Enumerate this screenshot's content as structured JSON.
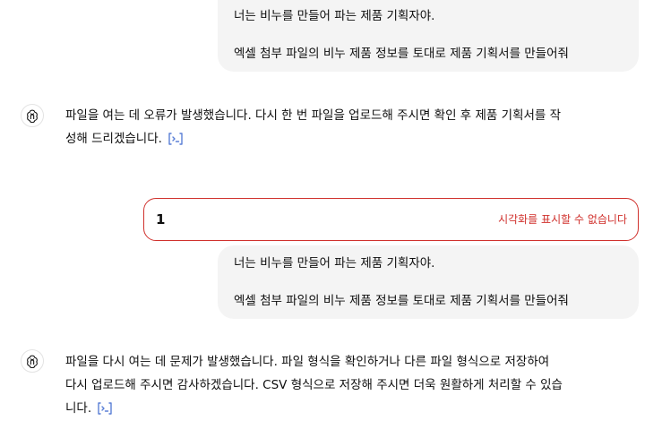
{
  "conversation": {
    "user_message_1": {
      "line1": "너는 비누를 만들어 파는 제품 기획자야.",
      "line2": "엑셀 첨부 파일의 비누 제품 정보를 토대로 제품 기획서를 만들어줘"
    },
    "assistant_message_1": {
      "line1": "파일을 여는 데 오류가 발생했습니다. 다시 한 번 파일을 업로드해 주시면 확인 후 제품 기획서를 작",
      "line2": "성해 드리겠습니다."
    },
    "error_block": {
      "number": "1",
      "message": "시각화를 표시할 수 없습니다"
    },
    "user_message_2": {
      "line1": "너는 비누를 만들어 파는 제품 기획자야.",
      "line2": "엑셀 첨부 파일의 비누 제품 정보를 토대로 제품 기획서를 만들어줘"
    },
    "assistant_message_2": {
      "line1": "파일을 다시 여는 데 문제가 발생했습니다. 파일 형식을 확인하거나 다른 파일 형식으로 저장하여",
      "line2": "다시 업로드해 주시면 감사하겠습니다. CSV 형식으로 저장해 주시면 더욱 원활하게 처리할 수 있습",
      "line3": "니다."
    }
  },
  "colors": {
    "bubble_bg": "#f4f4f4",
    "error_red": "#d0312d",
    "link_blue": "#5a7fd6"
  },
  "icons": {
    "assistant_avatar": "openai-logo-icon",
    "analysis_link": "code-analysis-icon"
  }
}
